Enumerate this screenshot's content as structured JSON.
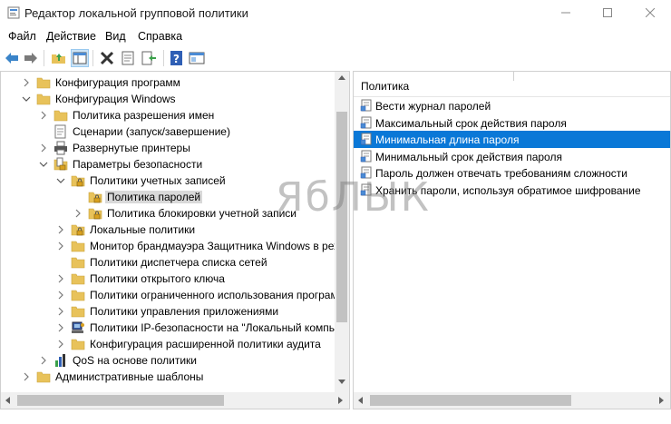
{
  "window": {
    "title": "Редактор локальной групповой политики"
  },
  "menu": [
    "Файл",
    "Действие",
    "Вид",
    "Справка"
  ],
  "toolbar": {
    "icons": [
      "back-arrow-icon",
      "forward-arrow-icon",
      "up-folder-icon",
      "show-tree-icon",
      "delete-icon",
      "properties-icon",
      "export-icon",
      "help-icon",
      "view-icon"
    ]
  },
  "tree": [
    {
      "label": "Конфигурация программ",
      "icon": "folder-icon"
    },
    {
      "label": "Конфигурация Windows",
      "icon": "folder-icon"
    },
    {
      "label": "Политика разрешения имен",
      "icon": "folder-icon"
    },
    {
      "label": "Сценарии (запуск/завершение)",
      "icon": "script-icon"
    },
    {
      "label": "Развернутые принтеры",
      "icon": "printer-icon"
    },
    {
      "label": "Параметры безопасности",
      "icon": "security-icon"
    },
    {
      "label": "Политики учетных записей",
      "icon": "folder-lock-icon"
    },
    {
      "label": "Политика паролей",
      "icon": "folder-lock-icon"
    },
    {
      "label": "Политика блокировки учетной записи",
      "icon": "folder-lock-icon"
    },
    {
      "label": "Локальные политики",
      "icon": "folder-lock-icon"
    },
    {
      "label": "Монитор брандмауэра Защитника Windows в реж",
      "icon": "folder-icon"
    },
    {
      "label": "Политики диспетчера списка сетей",
      "icon": "folder-icon"
    },
    {
      "label": "Политики открытого ключа",
      "icon": "folder-icon"
    },
    {
      "label": "Политики ограниченного использования програм",
      "icon": "folder-icon"
    },
    {
      "label": "Политики управления приложениями",
      "icon": "folder-icon"
    },
    {
      "label": "Политики IP-безопасности на \"Локальный компьк",
      "icon": "network-policy-icon"
    },
    {
      "label": "Конфигурация расширенной политики аудита",
      "icon": "folder-icon"
    },
    {
      "label": "QoS на основе политики",
      "icon": "chart-icon"
    },
    {
      "label": "Административные шаблоны",
      "icon": "folder-icon"
    }
  ],
  "right_pane": {
    "column_header": "Политика",
    "policies": [
      "Вести журнал паролей",
      "Максимальный срок действия пароля",
      "Минимальная длина пароля",
      "Минимальный срок действия пароля",
      "Пароль должен отвечать требованиям сложности",
      "Хранить пароли, используя обратимое шифрование"
    ],
    "selected_index": 2
  },
  "watermark": "ЯбЛЫК",
  "colors": {
    "selection": "#0a78d7",
    "folder": "#e8c25a",
    "tree_selection": "#d9d9d9"
  }
}
